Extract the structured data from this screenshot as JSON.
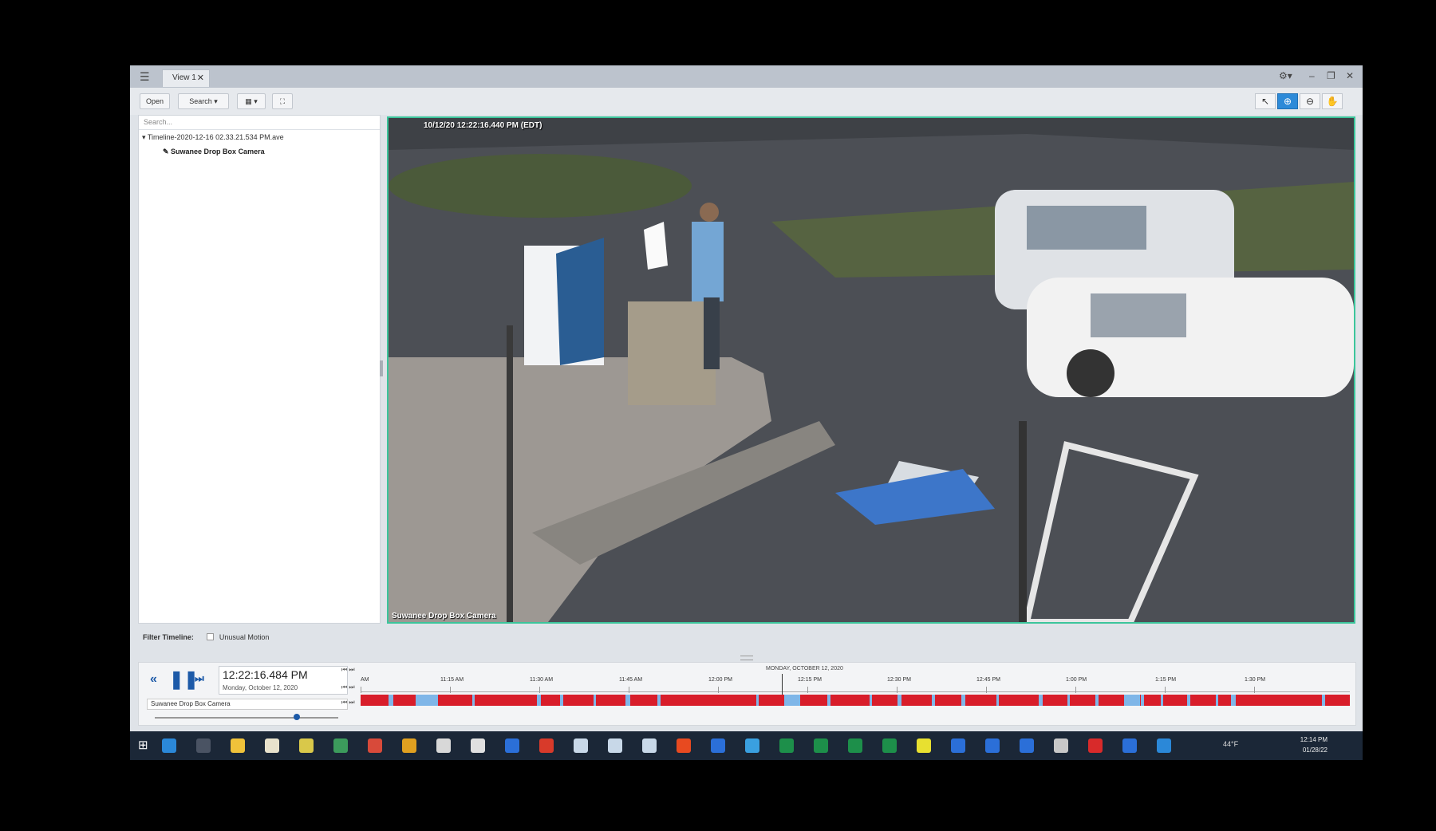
{
  "window": {
    "tab_label": "View 1",
    "tab_close": "✕",
    "menu_glyph": "☰",
    "controls": [
      "⚙▾",
      "–",
      "❐",
      "✕"
    ]
  },
  "toolbar": {
    "open_label": "Open",
    "search_label": "Search ▾",
    "layout_label": "▦ ▾",
    "fullscreen_label": "⛶",
    "right_tools": [
      "select-arrow-icon",
      "zoom-in-icon",
      "zoom-out-icon",
      "pan-hand-icon"
    ]
  },
  "sidebar": {
    "search_placeholder": "Search...",
    "tree_root": "Timeline-2020-12-16 02.33.21.534 PM.ave",
    "tree_child": "Suwanee Drop Box Camera"
  },
  "video": {
    "timestamp": "10/12/20 12:22:16.440 PM (EDT)",
    "camera_label": "Suwanee Drop Box Camera"
  },
  "filter": {
    "label": "Filter Timeline:",
    "option": "Unusual Motion"
  },
  "timeline": {
    "current_time": "12:22:16.484 PM",
    "current_date": "Monday, October 12, 2020",
    "camera_row": "Suwanee Drop Box Camera",
    "day_header": "MONDAY, OCTOBER 12, 2020",
    "ticks": [
      "AM",
      "11:15 AM",
      "11:30 AM",
      "11:45 AM",
      "12:00 PM",
      "12:15 PM",
      "12:30 PM",
      "12:45 PM",
      "1:00 PM",
      "1:15 PM",
      "1:30 PM"
    ],
    "bar_colors": {
      "recorded": "#d81d2a",
      "motion": "#7fb6e8"
    }
  },
  "taskbar": {
    "weather": "44°F",
    "time": "12:14 PM",
    "date": "01/28/22"
  }
}
